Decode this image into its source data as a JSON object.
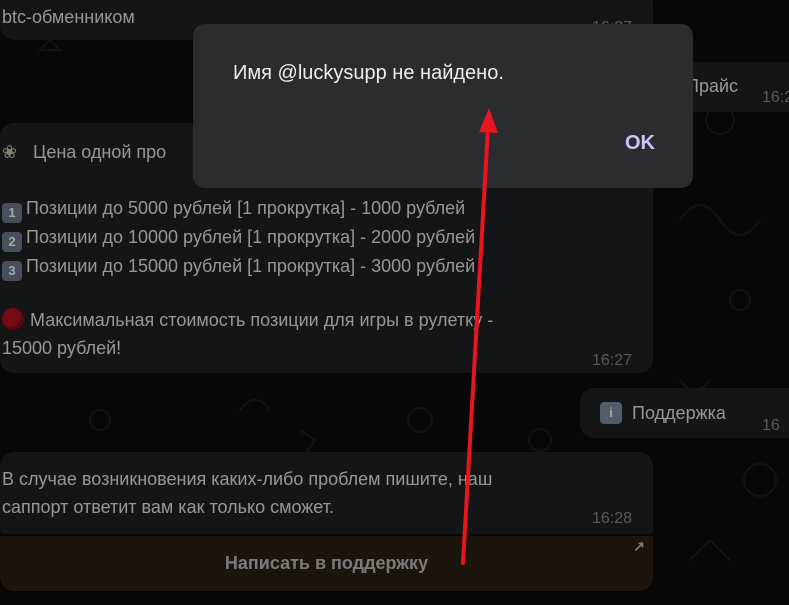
{
  "messages": {
    "top_text": "btc-обменником",
    "top_time": "16:27",
    "right_top_text": "Прайс",
    "right_top_time": "16:2",
    "price": {
      "heading": "Цена одной про",
      "lines": [
        {
          "num": "1",
          "text": "Позиции до 5000 рублей [1 прокрутка] - 1000 рублей"
        },
        {
          "num": "2",
          "text": "Позиции до 10000 рублей [1 прокрутка] - 2000 рублей"
        },
        {
          "num": "3",
          "text": "Позиции до 15000 рублей [1 прокрутка] - 3000 рублей"
        }
      ],
      "max_line1": "Максимальная стоимость позиции для игры в рулетку -",
      "max_line2": "15000 рублей!",
      "time": "16:27"
    },
    "support_chip": {
      "icon": "i",
      "text": "Поддержка",
      "time": "16"
    },
    "support_msg": {
      "line1": "В случае возникновения каких-либо проблем пишите, наш",
      "line2": "саппорт ответит вам как только сможет.",
      "time": "16:28"
    },
    "support_button": "Написать в поддержку",
    "support_button_icon": "↗"
  },
  "dialog": {
    "message": "Имя @luckysupp не найдено.",
    "ok_label": "OK"
  },
  "colors": {
    "bubble": "#202124",
    "dialog": "#2b2c30",
    "ok": "#cbc3f5",
    "arrow": "#e8141e"
  }
}
